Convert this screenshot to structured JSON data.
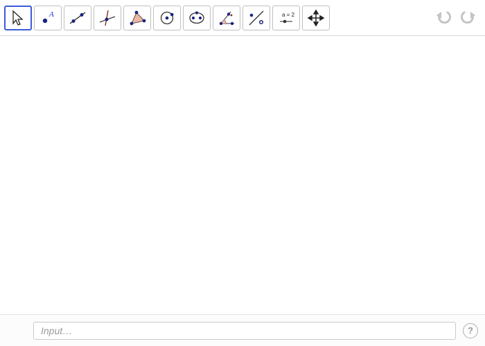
{
  "toolbar": {
    "tools": [
      {
        "name": "move-tool",
        "selected": true
      },
      {
        "name": "point-tool",
        "label": "A"
      },
      {
        "name": "line-tool"
      },
      {
        "name": "perpendicular-line-tool"
      },
      {
        "name": "polygon-tool"
      },
      {
        "name": "circle-center-point-tool"
      },
      {
        "name": "ellipse-tool"
      },
      {
        "name": "angle-tool"
      },
      {
        "name": "reflect-line-tool"
      },
      {
        "name": "slider-tool",
        "label": "a = 2"
      },
      {
        "name": "move-view-tool"
      }
    ]
  },
  "undo_redo": {
    "undo": "Undo",
    "redo": "Redo"
  },
  "input": {
    "placeholder": "Input…"
  },
  "help": {
    "label": "?"
  },
  "colors": {
    "dot": "#1a237e",
    "fill": "#e8b8a8",
    "stroke": "#333"
  }
}
